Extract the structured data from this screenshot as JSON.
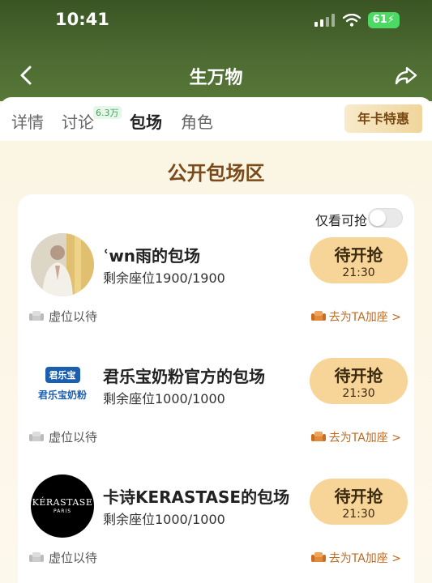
{
  "status_bar": {
    "time": "10:41",
    "battery": "61"
  },
  "navbar": {
    "title": "生万物"
  },
  "tabs": [
    {
      "label": "详情"
    },
    {
      "label": "讨论",
      "badge": "6.3万"
    },
    {
      "label": "包场"
    },
    {
      "label": "角色"
    }
  ],
  "year_card": {
    "label": "年卡特惠"
  },
  "section": {
    "title": "公开包场区"
  },
  "filter": {
    "label": "仅看可抢"
  },
  "sessions": [
    {
      "title": "ʿwn雨的包场",
      "seats": "剩余座位1900/1900",
      "button_label": "待开抢",
      "button_time": "21:30",
      "vacant_label": "虚位以待",
      "add_label": "去为TA加座 >"
    },
    {
      "title": "君乐宝奶粉官方的包场",
      "seats": "剩余座位1000/1000",
      "button_label": "待开抢",
      "button_time": "21:30",
      "vacant_label": "虚位以待",
      "add_label": "去为TA加座 >",
      "logo_top": "君乐宝",
      "logo_bottom": "君乐宝奶粉"
    },
    {
      "title": "卡诗KERASTASE的包场",
      "seats": "剩余座位1000/1000",
      "button_label": "待开抢",
      "button_time": "21:30",
      "vacant_label": "虚位以待",
      "add_label": "去为TA加座 >",
      "logo_top": "KÉRASTASE",
      "logo_bottom": "PARIS"
    }
  ],
  "colors": {
    "header_green": "#4c6a32",
    "accent_brown": "#7b4a1a",
    "button_bg": "#f7d498",
    "link_orange": "#c06a1e"
  }
}
